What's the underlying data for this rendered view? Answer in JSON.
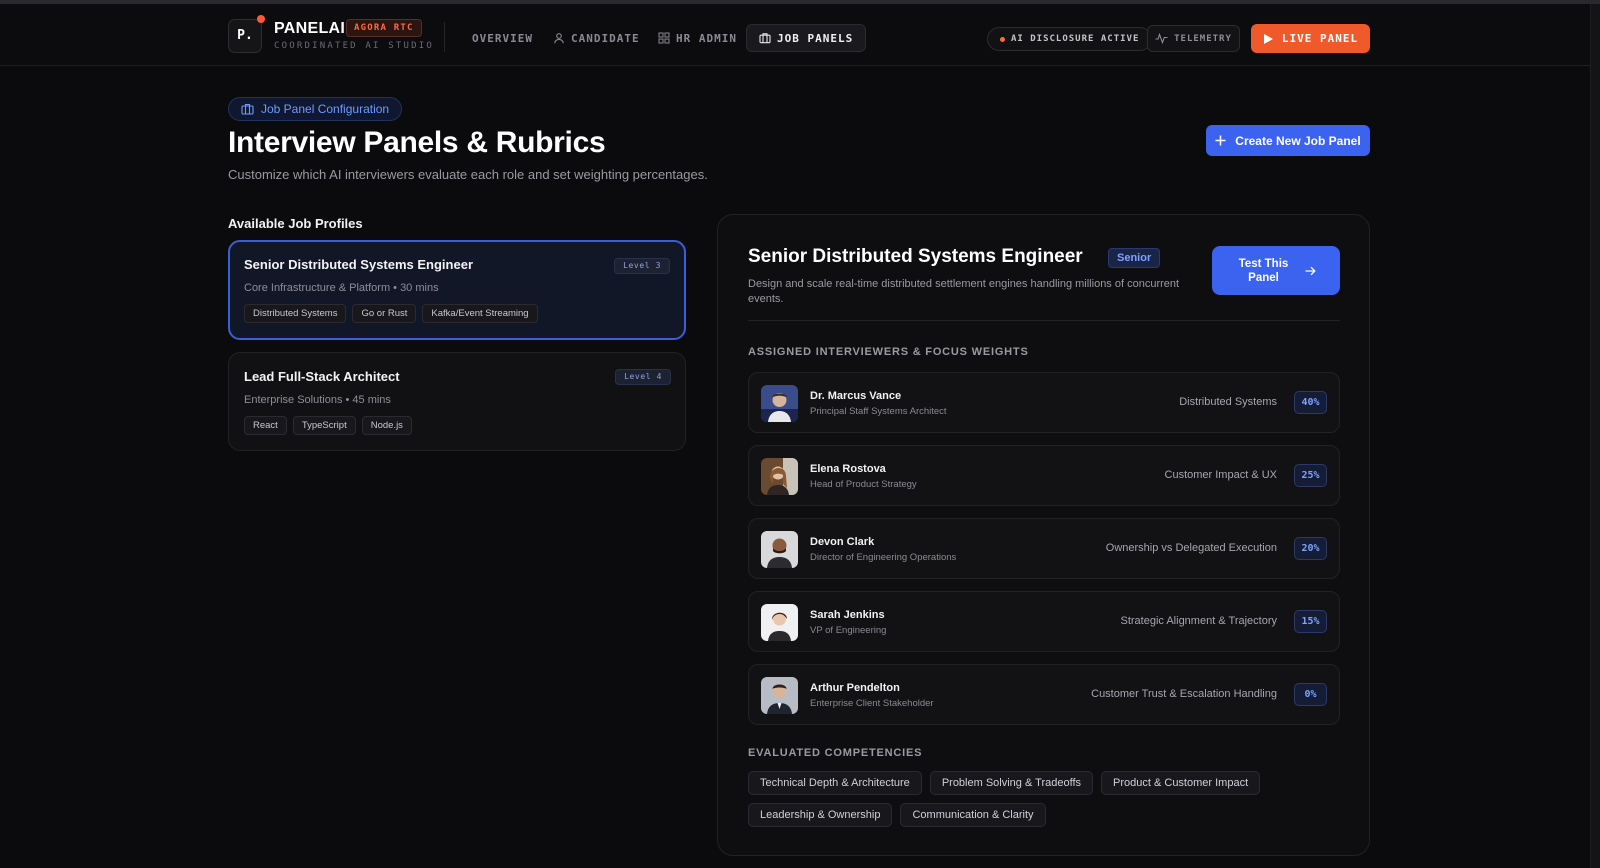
{
  "brand": {
    "logo": "P.",
    "name": "PANELAI",
    "badge": "AGORA RTC",
    "subtitle": "COORDINATED AI STUDIO"
  },
  "nav": {
    "items": [
      {
        "label": "OVERVIEW",
        "icon": "none"
      },
      {
        "label": "CANDIDATE",
        "icon": "user-icon"
      },
      {
        "label": "HR ADMIN",
        "icon": "grid-icon"
      },
      {
        "label": "JOB PANELS",
        "icon": "briefcase-icon",
        "active": true
      }
    ],
    "disclosure": "AI DISCLOSURE ACTIVE",
    "telemetry": "TELEMETRY",
    "live": "LIVE PANEL"
  },
  "header": {
    "chip": "Job Panel Configuration",
    "title": "Interview Panels & Rubrics",
    "subtitle": "Customize which AI interviewers evaluate each role and set weighting percentages.",
    "create_button": "Create New Job Panel"
  },
  "profiles": {
    "heading": "Available Job Profiles",
    "items": [
      {
        "title": "Senior Distributed Systems Engineer",
        "meta": "Core Infrastructure & Platform • 30 mins",
        "level": "Level 3",
        "tags": [
          "Distributed Systems",
          "Go or Rust",
          "Kafka/Event Streaming"
        ]
      },
      {
        "title": "Lead Full-Stack Architect",
        "meta": "Enterprise Solutions • 45 mins",
        "level": "Level 4",
        "tags": [
          "React",
          "TypeScript",
          "Node.js"
        ]
      }
    ]
  },
  "detail": {
    "title": "Senior Distributed Systems Engineer",
    "badge": "Senior",
    "description": "Design and scale real-time distributed settlement engines handling millions of concurrent events.",
    "test_button": "Test This Panel",
    "interviewers_heading": "ASSIGNED INTERVIEWERS & FOCUS WEIGHTS",
    "interviewers": [
      {
        "name": "Dr. Marcus Vance",
        "role": "Principal Staff Systems Architect",
        "focus": "Distributed Systems",
        "weight": "40%"
      },
      {
        "name": "Elena Rostova",
        "role": "Head of Product Strategy",
        "focus": "Customer Impact & UX",
        "weight": "25%"
      },
      {
        "name": "Devon Clark",
        "role": "Director of Engineering Operations",
        "focus": "Ownership vs Delegated Execution",
        "weight": "20%"
      },
      {
        "name": "Sarah Jenkins",
        "role": "VP of Engineering",
        "focus": "Strategic Alignment & Trajectory",
        "weight": "15%"
      },
      {
        "name": "Arthur Pendelton",
        "role": "Enterprise Client Stakeholder",
        "focus": "Customer Trust & Escalation Handling",
        "weight": "0%"
      }
    ],
    "competencies_heading": "EVALUATED COMPETENCIES",
    "competencies": [
      "Technical Depth & Architecture",
      "Problem Solving & Tradeoffs",
      "Product & Customer Impact",
      "Leadership & Ownership",
      "Communication & Clarity"
    ]
  },
  "colors": {
    "accent": "#3b63f0",
    "live": "#f05a2a",
    "background": "#0b0b0d"
  }
}
